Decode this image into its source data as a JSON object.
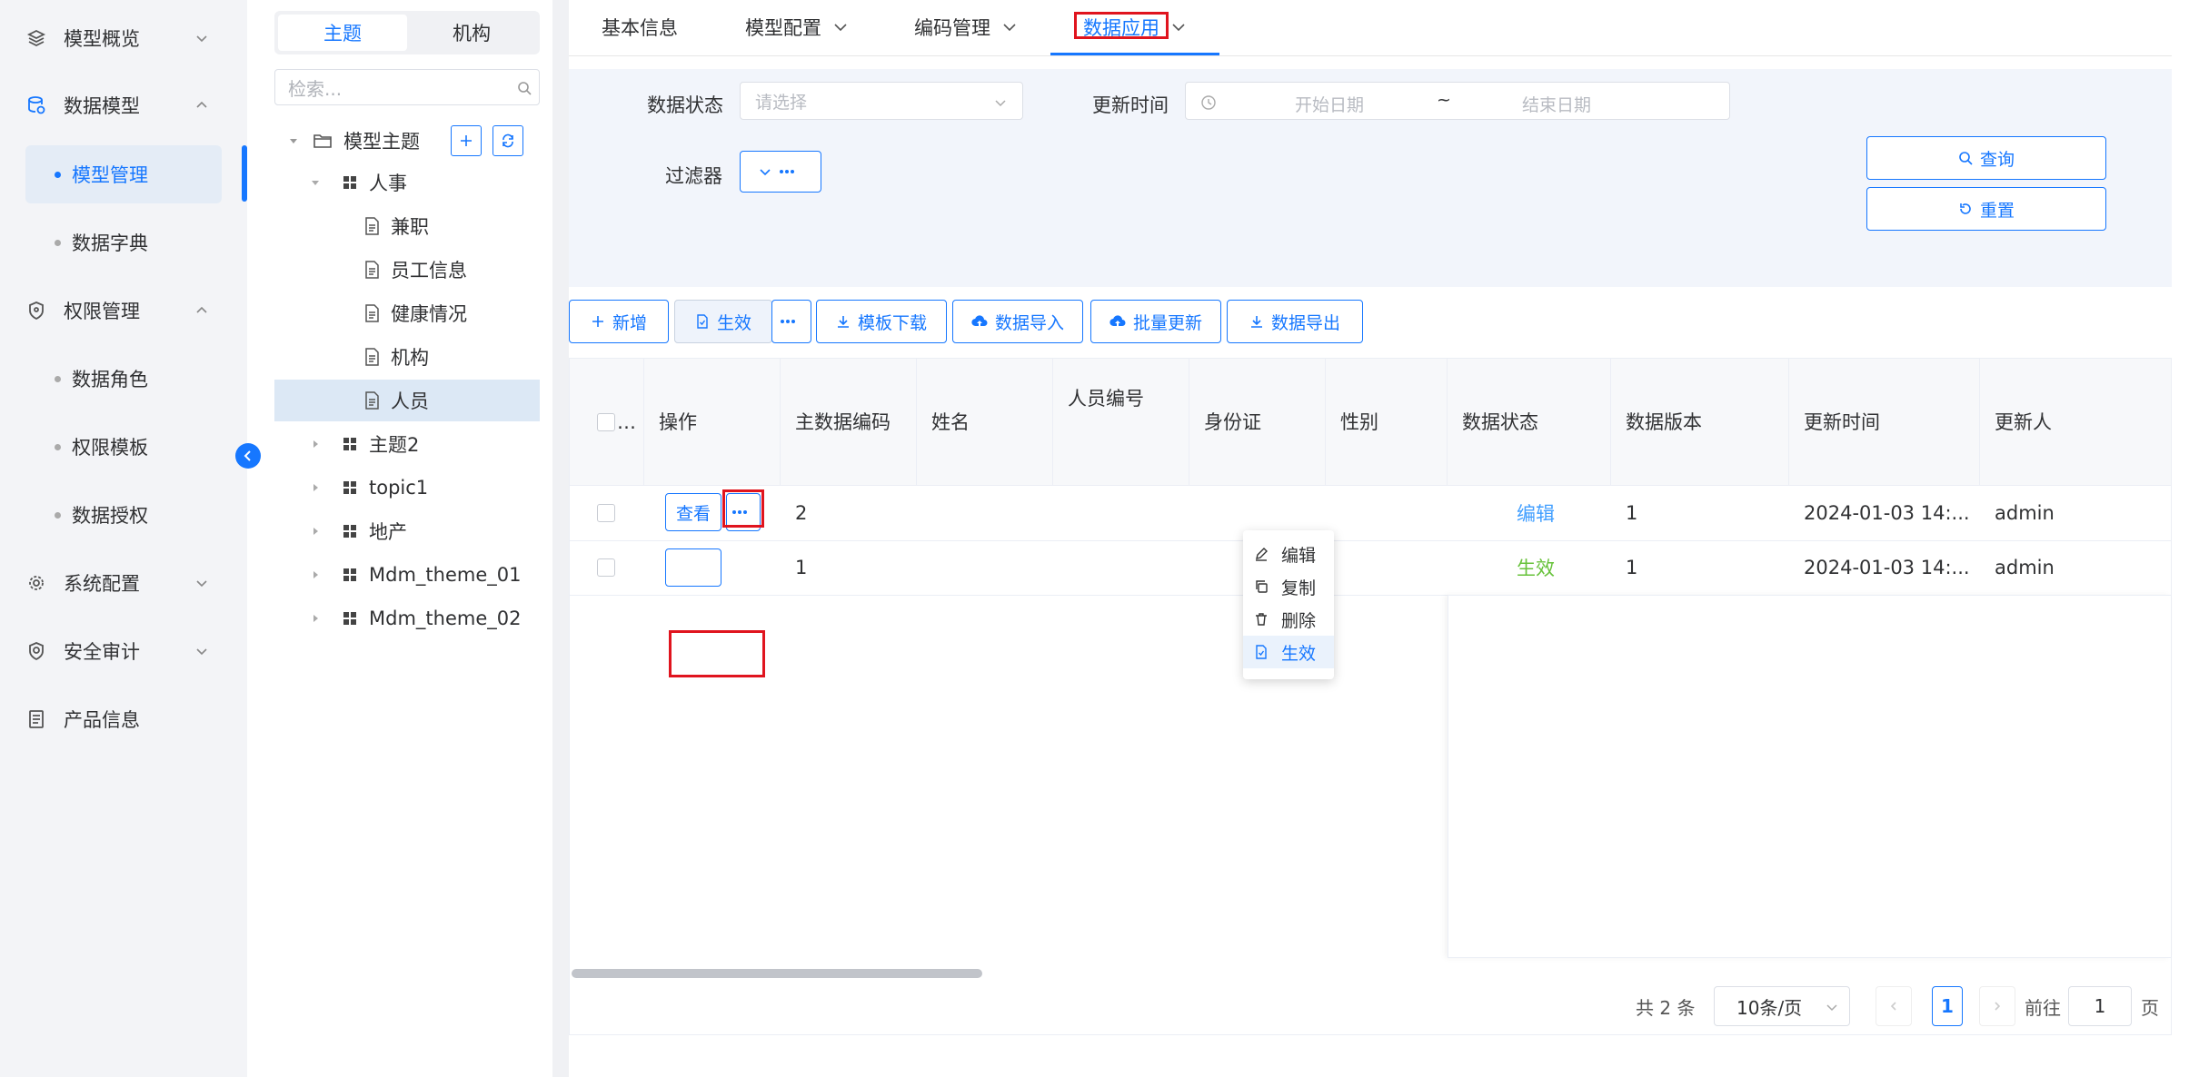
{
  "nav": {
    "items": [
      {
        "label": "模型概览",
        "icon": "layers-icon",
        "expanded": false
      },
      {
        "label": "数据模型",
        "icon": "database-icon",
        "expanded": true
      },
      {
        "label": "权限管理",
        "icon": "shield-icon",
        "expanded": true
      },
      {
        "label": "系统配置",
        "icon": "gear-icon",
        "expanded": false
      },
      {
        "label": "安全审计",
        "icon": "audit-icon",
        "expanded": false
      },
      {
        "label": "产品信息",
        "icon": "document-icon"
      }
    ],
    "sub_model": [
      "模型管理",
      "数据字典"
    ],
    "sub_perm": [
      "数据角色",
      "权限模板",
      "数据授权"
    ],
    "active": "模型管理"
  },
  "tree": {
    "tabs": [
      "主题",
      "机构"
    ],
    "active_tab": "主题",
    "search_placeholder": "检索...",
    "root": "模型主题",
    "nodes": [
      {
        "label": "人事",
        "level": 1,
        "type": "theme",
        "expanded": true
      },
      {
        "label": "兼职",
        "level": 2,
        "type": "model"
      },
      {
        "label": "员工信息",
        "level": 2,
        "type": "model"
      },
      {
        "label": "健康情况",
        "level": 2,
        "type": "model"
      },
      {
        "label": "机构",
        "level": 2,
        "type": "model"
      },
      {
        "label": "人员",
        "level": 2,
        "type": "model",
        "selected": true
      },
      {
        "label": "主题2",
        "level": 1,
        "type": "theme"
      },
      {
        "label": "topic1",
        "level": 1,
        "type": "theme"
      },
      {
        "label": "地产",
        "level": 1,
        "type": "theme"
      },
      {
        "label": "Mdm_theme_01",
        "level": 1,
        "type": "theme"
      },
      {
        "label": "Mdm_theme_02",
        "level": 1,
        "type": "theme"
      }
    ]
  },
  "tabs": [
    {
      "label": "基本信息",
      "dropdown": false
    },
    {
      "label": "模型配置",
      "dropdown": true
    },
    {
      "label": "编码管理",
      "dropdown": true
    },
    {
      "label": "数据应用",
      "dropdown": true,
      "active": true
    }
  ],
  "filter": {
    "status_label": "数据状态",
    "status_placeholder": "请选择",
    "time_label": "更新时间",
    "start_placeholder": "开始日期",
    "separator": "~",
    "end_placeholder": "结束日期",
    "filter_label": "过滤器",
    "query": "查询",
    "reset": "重置"
  },
  "toolbar": {
    "add": "新增",
    "activate": "生效",
    "template_download": "模板下载",
    "import": "数据导入",
    "batch_update": "批量更新",
    "export": "数据导出"
  },
  "table": {
    "select_all_ellipsis": "…",
    "columns": [
      "操作",
      "主数据编码",
      "姓名",
      "人员编号",
      "身份证",
      "性别",
      "数据状态",
      "数据版本",
      "更新时间",
      "更新人"
    ],
    "view_label": "查看",
    "rows": [
      {
        "code": "2",
        "name": "",
        "emp_no": "",
        "id_card": "",
        "gender": "",
        "status": "编辑",
        "status_color": "#409eff",
        "version": "1",
        "updated": "2024-01-03 14:...",
        "updater": "admin"
      },
      {
        "code": "1",
        "name": "",
        "emp_no": "",
        "id_card": "",
        "gender": "",
        "status": "生效",
        "status_color": "#67c23a",
        "version": "1",
        "updated": "2024-01-03 14:...",
        "updater": "admin"
      }
    ]
  },
  "menu": {
    "items": [
      {
        "label": "编辑",
        "icon": "edit-icon"
      },
      {
        "label": "复制",
        "icon": "copy-icon"
      },
      {
        "label": "删除",
        "icon": "trash-icon"
      },
      {
        "label": "生效",
        "icon": "activate-icon",
        "highlighted": true
      }
    ]
  },
  "pagination": {
    "total": "共 2 条",
    "page_size": "10条/页",
    "current": "1",
    "goto_prefix": "前往",
    "goto_value": "1",
    "goto_suffix": "页"
  },
  "colors": {
    "accent": "#1677ff",
    "highlight": "#e0141e",
    "status_edit": "#409eff",
    "status_active": "#67c23a"
  }
}
